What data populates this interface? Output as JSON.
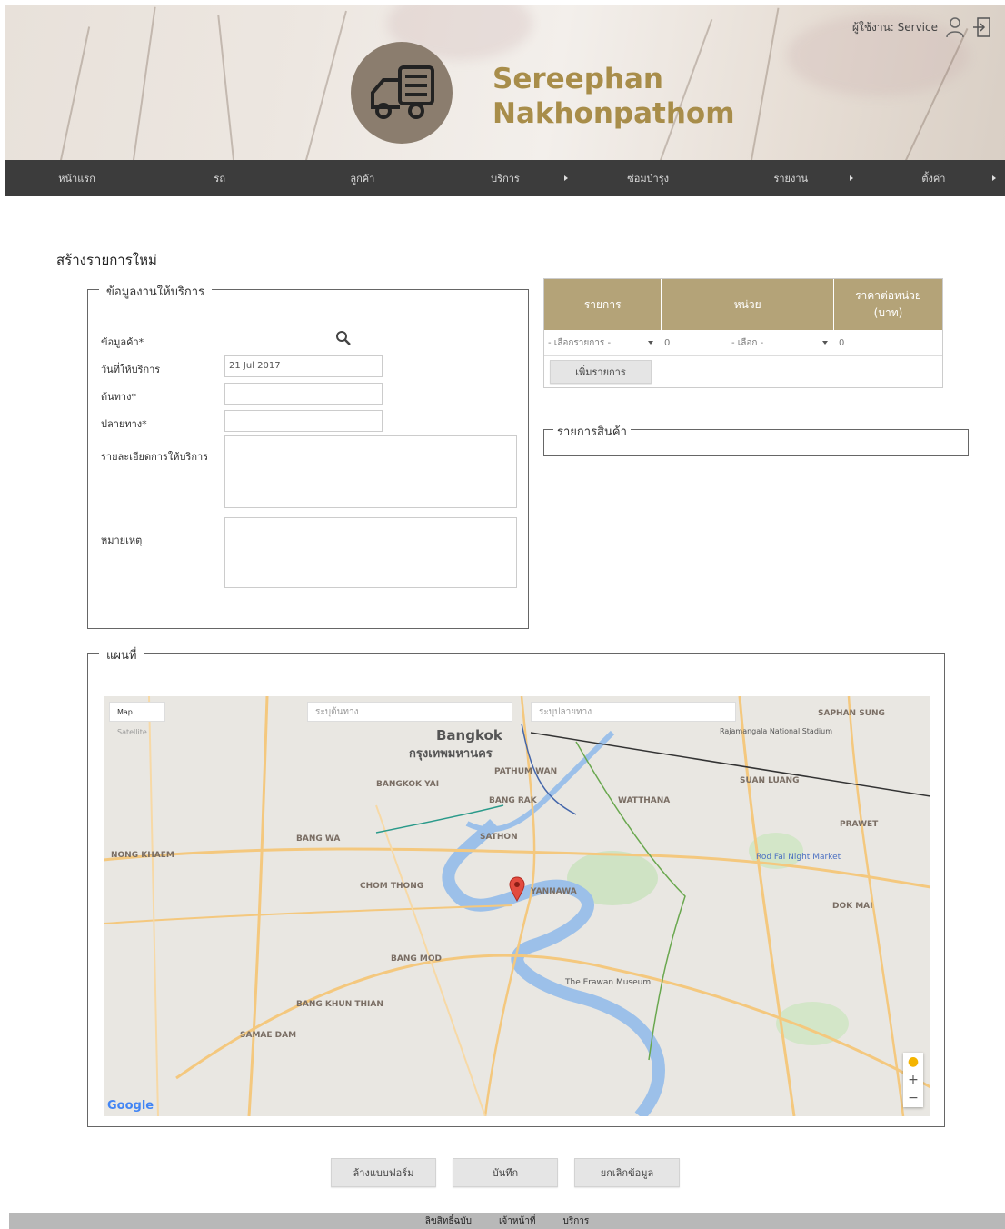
{
  "header": {
    "brand_line1": "Sereephan",
    "brand_line2": "Nakhonpathom",
    "user_label": "ผู้ใช้งาน: Service",
    "brand_color": "#a88d4a"
  },
  "nav": {
    "items": [
      {
        "label": "หน้าแรก",
        "has_submenu": false
      },
      {
        "label": "รถ",
        "has_submenu": false
      },
      {
        "label": "ลูกค้า",
        "has_submenu": false
      },
      {
        "label": "บริการ",
        "has_submenu": true
      },
      {
        "label": "ซ่อมบำรุง",
        "has_submenu": false
      },
      {
        "label": "รายงาน",
        "has_submenu": true
      },
      {
        "label": "ตั้งค่า",
        "has_submenu": true
      }
    ]
  },
  "page": {
    "title": "สร้างรายการใหม่"
  },
  "service_info": {
    "legend": "ข้อมูลงานให้บริการ",
    "customer_label": "ข้อมูลค้า*",
    "date_label": "วันที่ให้บริการ",
    "date_value": "21 Jul 2017",
    "origin_label": "ต้นทาง*",
    "destination_label": "ปลายทาง*",
    "details_label": "รายละเอียดการให้บริการ",
    "note_label": "หมายเหตุ"
  },
  "items_table": {
    "headers": [
      "รายการ",
      "หน่วย",
      "ราคาต่อหน่วย (บาท)"
    ],
    "row": {
      "item_select": "- เลือกรายการ -",
      "qty": "0",
      "unit_select": "- เลือก -",
      "price": "0"
    },
    "add_button": "เพิ่มรายการ",
    "header_color": "#b4a378"
  },
  "products": {
    "legend": "รายการสินค้า"
  },
  "map": {
    "legend": "แผนที่",
    "type_map": "Map",
    "type_satellite": "Satellite",
    "origin_placeholder": "ระบุต้นทาง",
    "destination_placeholder": "ระบุปลายทาง",
    "city_en": "Bangkok",
    "city_th": "กรุงเทพมหานคร",
    "labels": [
      "WATTHANA",
      "PATHUM WAN",
      "BANGKOK YAI",
      "BANG RAK",
      "SATHON",
      "BANG WA",
      "NONG KHAEM",
      "CHOM THONG",
      "BANG MOD",
      "BANG KHUN THIAN",
      "SAMAE DAM",
      "PRAWET",
      "DOK MAI",
      "SUAN LUANG",
      "SAPHAN SUNG",
      "Rod Fai Night Market",
      "The Erawan Museum",
      "Rajamangala National Stadium",
      "YANNAWA"
    ],
    "google": "Google"
  },
  "actions": {
    "reset": "ล้างแบบฟอร์ม",
    "save": "บันทึก",
    "cancel": "ยกเลิกข้อมูล"
  },
  "footer": {
    "items": [
      "ลิขสิทธิ์ฉบับ",
      "เจ้าหน้าที่",
      "บริการ"
    ]
  }
}
